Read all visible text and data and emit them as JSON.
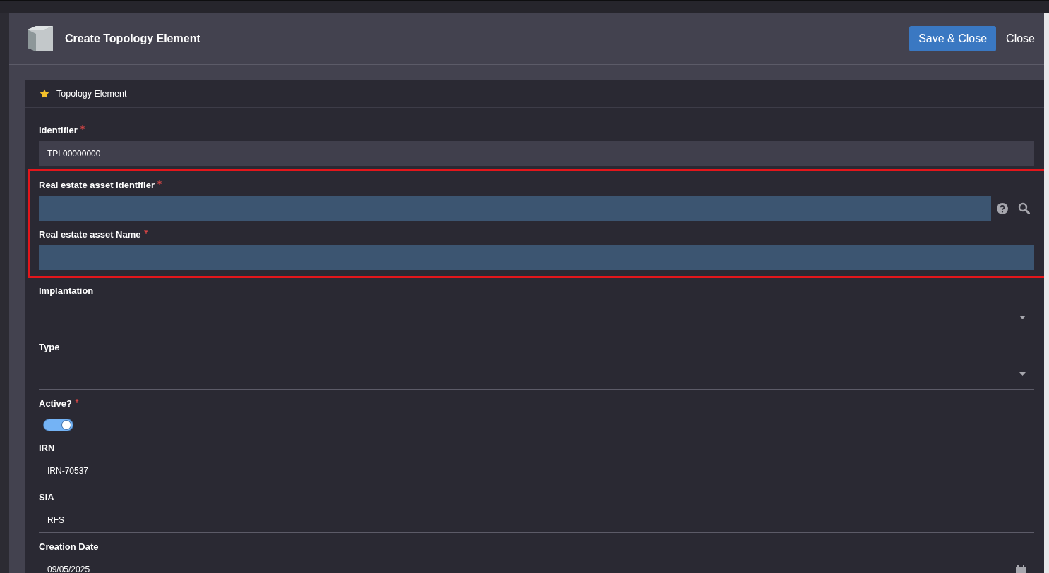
{
  "dialog": {
    "title": "Create Topology Element",
    "buttons": [
      {
        "label": "Save & Close",
        "kind": "primary"
      },
      {
        "label": "Close",
        "kind": "link"
      }
    ]
  },
  "section": {
    "title": "Topology Element"
  },
  "fields": [
    {
      "kind": "box",
      "label": "Identifier",
      "required": true,
      "value": "TPL00000000"
    },
    {
      "kind": "lookup",
      "label": "Real estate asset Identifier",
      "required": true,
      "framed": true
    },
    {
      "kind": "box",
      "label": "Real estate asset Name",
      "required": true,
      "framed": true
    },
    {
      "kind": "select",
      "label": "Implantation"
    },
    {
      "kind": "select",
      "label": "Type"
    },
    {
      "kind": "toggle",
      "label": "Active?",
      "required": true,
      "on": true
    },
    {
      "kind": "line",
      "label": "IRN",
      "value": "IRN-70537"
    },
    {
      "kind": "line",
      "label": "SIA",
      "value": "RFS"
    },
    {
      "kind": "date",
      "label": "Creation Date",
      "value": "09/05/2025"
    }
  ]
}
